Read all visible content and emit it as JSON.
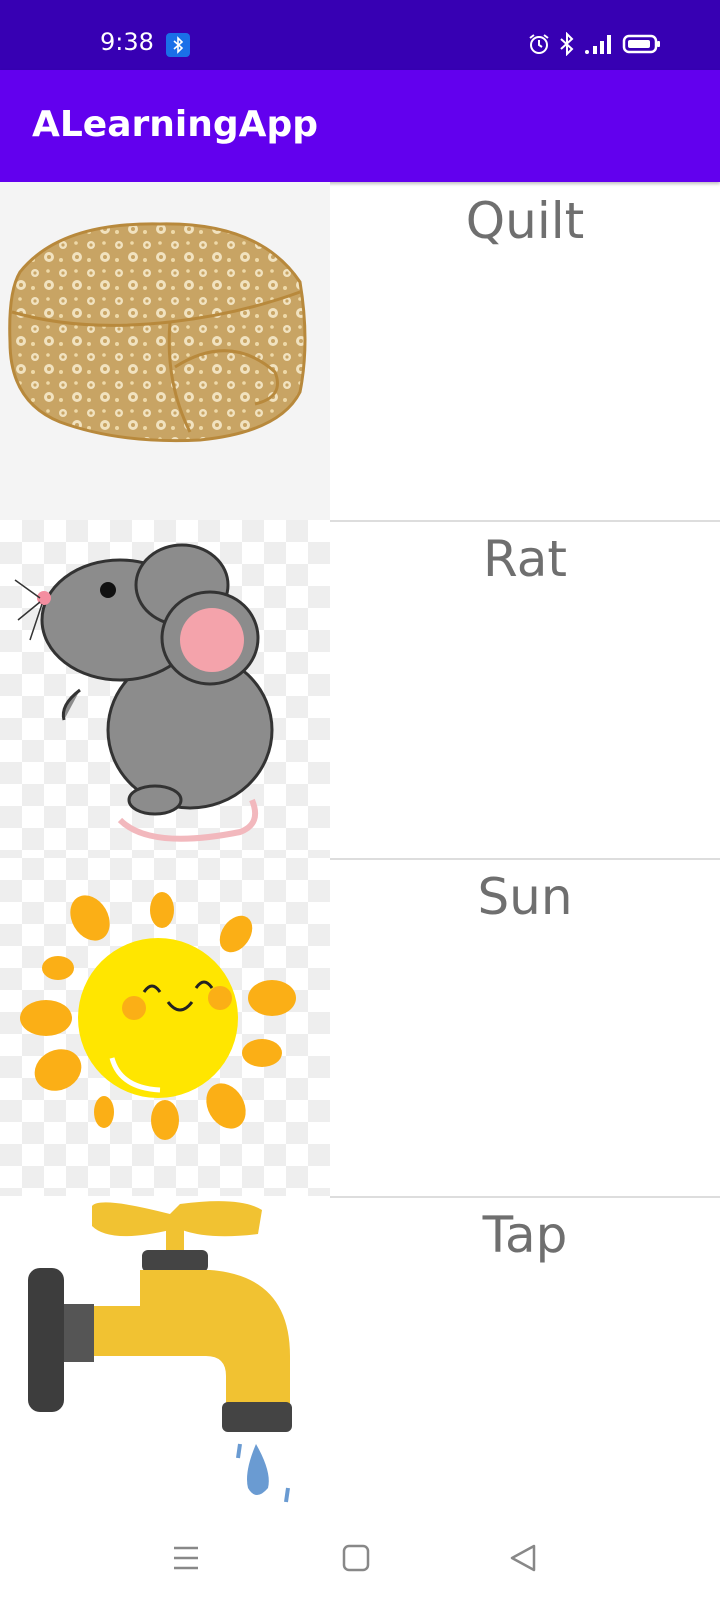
{
  "status_bar": {
    "time": "9:38",
    "icons": [
      "bluetooth-badge-icon",
      "alarm-icon",
      "bluetooth-icon",
      "signal-icon",
      "battery-icon"
    ],
    "background": "#3700b3"
  },
  "app_bar": {
    "title": "ALearningApp",
    "background": "#6200ee"
  },
  "items": [
    {
      "label": "Quilt",
      "image": "quilt-image"
    },
    {
      "label": "Rat",
      "image": "rat-image"
    },
    {
      "label": "Sun",
      "image": "sun-image"
    },
    {
      "label": "Tap",
      "image": "tap-image"
    }
  ],
  "nav_bar": {
    "buttons": [
      "menu-icon",
      "home-icon",
      "back-icon"
    ]
  }
}
